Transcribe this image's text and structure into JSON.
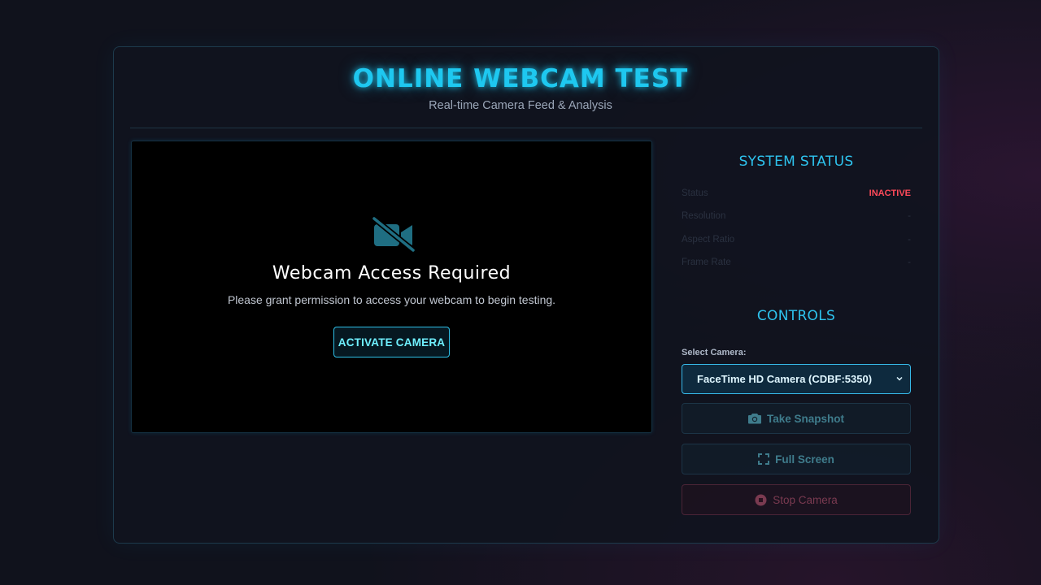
{
  "header": {
    "title": "ONLINE WEBCAM TEST",
    "subtitle": "Real-time Camera Feed & Analysis"
  },
  "video": {
    "icon": "video-off-icon",
    "heading": "Webcam Access Required",
    "message": "Please grant permission to access your webcam to begin testing.",
    "activate_label": "ACTIVATE CAMERA"
  },
  "status": {
    "title": "SYSTEM STATUS",
    "rows": [
      {
        "label": "Status",
        "value": "INACTIVE"
      },
      {
        "label": "Resolution",
        "value": "-"
      },
      {
        "label": "Aspect Ratio",
        "value": "-"
      },
      {
        "label": "Frame Rate",
        "value": "-"
      }
    ]
  },
  "controls": {
    "title": "CONTROLS",
    "select_label": "Select Camera:",
    "selected_camera": "FaceTime HD Camera (CDBF:5350)",
    "snapshot_label": "Take Snapshot",
    "fullscreen_label": "Full Screen",
    "stop_label": "Stop Camera"
  },
  "colors": {
    "accent": "#1ec8f0",
    "inactive": "#ff4a5a",
    "background": "#10121c"
  }
}
